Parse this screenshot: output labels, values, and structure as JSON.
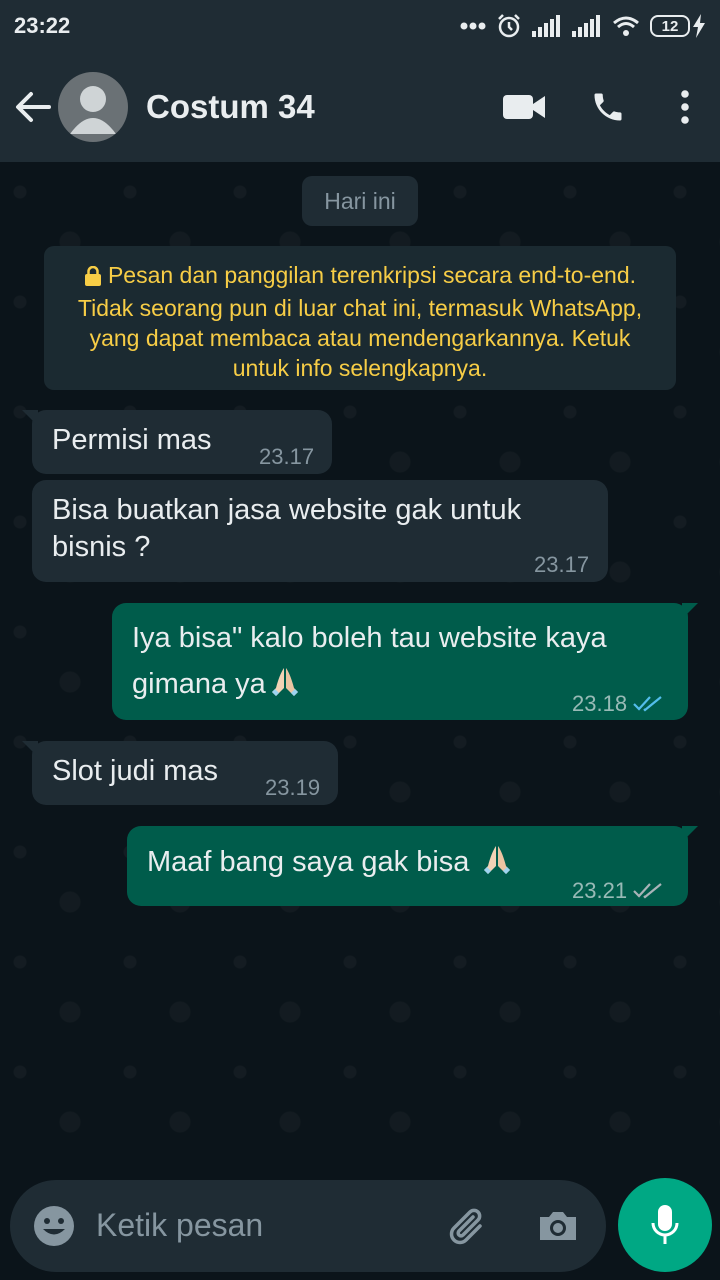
{
  "status_bar": {
    "time": "23:22",
    "battery": "12"
  },
  "header": {
    "contact_name": "Costum 34"
  },
  "chat": {
    "date_chip": "Hari ini",
    "encryption_notice": "Pesan dan panggilan terenkripsi secara end-to-end. Tidak seorang pun di luar chat ini, termasuk WhatsApp, yang dapat membaca atau mendengarkannya. Ketuk untuk info selengkapnya.",
    "messages": [
      {
        "direction": "incoming",
        "text": "Permisi mas",
        "time": "23.17"
      },
      {
        "direction": "incoming",
        "text": "Bisa buatkan jasa website gak untuk bisnis ?",
        "time": "23.17"
      },
      {
        "direction": "outgoing",
        "text": "Iya bisa\" kalo boleh tau website kaya gimana ya",
        "emoji": "folded-hands",
        "time": "23.18",
        "status": "read"
      },
      {
        "direction": "incoming",
        "text": "Slot judi mas",
        "time": "23.19"
      },
      {
        "direction": "outgoing",
        "text": "Maaf bang saya gak bisa",
        "emoji": "folded-hands",
        "time": "23.21",
        "status": "delivered"
      }
    ]
  },
  "composer": {
    "placeholder": "Ketik pesan"
  },
  "colors": {
    "incoming_bubble": "#1f2c34",
    "outgoing_bubble": "#005c4b",
    "read_ticks": "#53bdeb",
    "encryption_text": "#f7cd46",
    "mic_button": "#00a884"
  }
}
